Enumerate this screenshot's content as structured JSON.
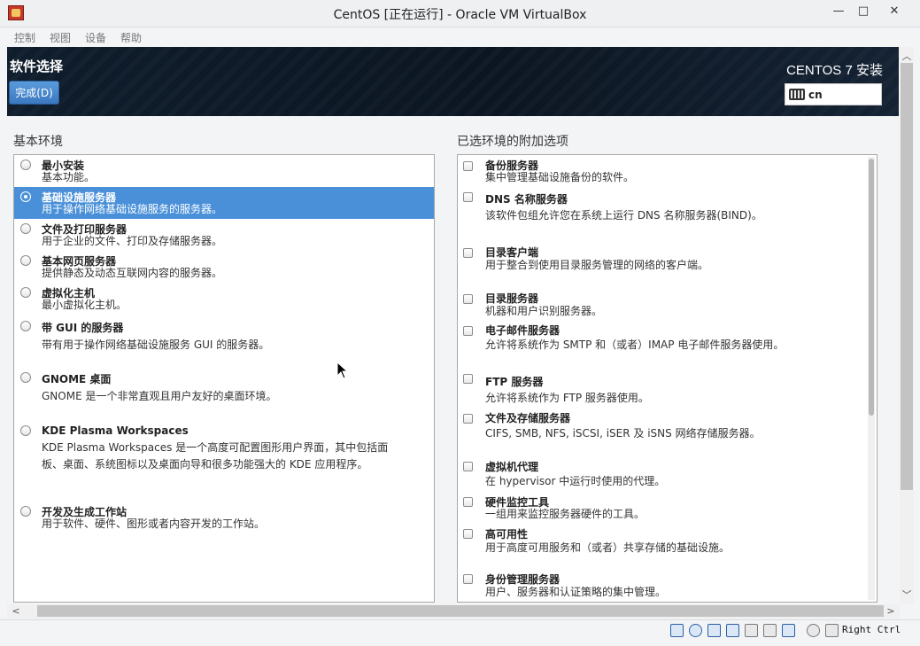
{
  "window": {
    "title": "CentOS [正在运行] - Oracle VM VirtualBox",
    "controls": {
      "minimize": "—",
      "maximize": "□",
      "close": "✕"
    }
  },
  "menu": [
    "控制",
    "视图",
    "设备",
    "帮助"
  ],
  "header": {
    "title": "软件选择",
    "done_label": "完成(D)",
    "product": "CENTOS 7 安装",
    "keyboard_layout": "cn"
  },
  "base_env": {
    "title": "基本环境",
    "items": [
      {
        "name": "最小安装",
        "desc": "基本功能。",
        "selected": false
      },
      {
        "name": "基础设施服务器",
        "desc": "用于操作网络基础设施服务的服务器。",
        "selected": true
      },
      {
        "name": "文件及打印服务器",
        "desc": "用于企业的文件、打印及存储服务器。",
        "selected": false
      },
      {
        "name": "基本网页服务器",
        "desc": "提供静态及动态互联网内容的服务器。",
        "selected": false
      },
      {
        "name": "虚拟化主机",
        "desc": "最小虚拟化主机。",
        "selected": false
      },
      {
        "name": "带 GUI 的服务器",
        "desc": "带有用于操作网络基础设施服务 GUI 的服务器。",
        "selected": false
      },
      {
        "name": "GNOME 桌面",
        "desc": "GNOME 是一个非常直观且用户友好的桌面环境。",
        "selected": false
      },
      {
        "name": "KDE Plasma Workspaces",
        "desc": "KDE Plasma Workspaces 是一个高度可配置图形用户界面，其中包括面",
        "desc2": "板、桌面、系统图标以及桌面向导和很多功能强大的 KDE 应用程序。",
        "selected": false
      },
      {
        "name": "开发及生成工作站",
        "desc": "用于软件、硬件、图形或者内容开发的工作站。",
        "selected": false
      }
    ]
  },
  "addons": {
    "title": "已选环境的附加选项",
    "items": [
      {
        "name": "备份服务器",
        "desc": "集中管理基础设施备份的软件。",
        "checked": false
      },
      {
        "name": "DNS 名称服务器",
        "desc": "该软件包组允许您在系统上运行 DNS 名称服务器(BIND)。",
        "checked": false
      },
      {
        "name": "目录客户端",
        "desc": "用于整合到使用目录服务管理的网络的客户端。",
        "checked": false
      },
      {
        "name": "目录服务器",
        "desc": "机器和用户识别服务器。",
        "checked": false
      },
      {
        "name": "电子邮件服务器",
        "desc": "允许将系统作为 SMTP 和（或者）IMAP 电子邮件服务器使用。",
        "checked": false
      },
      {
        "name": "FTP 服务器",
        "desc": "允许将系统作为 FTP 服务器使用。",
        "checked": false
      },
      {
        "name": "文件及存储服务器",
        "desc": "CIFS, SMB, NFS, iSCSI, iSER 及 iSNS 网络存储服务器。",
        "checked": false
      },
      {
        "name": "虚拟机代理",
        "desc": "在 hypervisor 中运行时使用的代理。",
        "checked": false
      },
      {
        "name": "硬件监控工具",
        "desc": "一组用来监控服务器硬件的工具。",
        "checked": false
      },
      {
        "name": "高可用性",
        "desc": "用于高度可用服务和（或者）共享存储的基础设施。",
        "checked": false
      },
      {
        "name": "身份管理服务器",
        "desc": "用户、服务器和认证策略的集中管理。",
        "checked": false
      }
    ]
  },
  "statusbar": {
    "host_key": "Right Ctrl"
  }
}
